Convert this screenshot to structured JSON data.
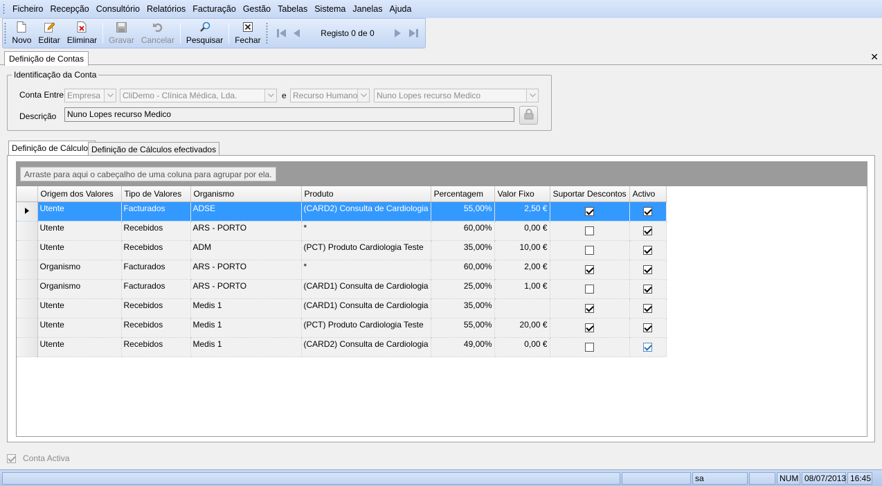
{
  "menu": [
    "Ficheiro",
    "Recepção",
    "Consultório",
    "Relatórios",
    "Facturação",
    "Gestão",
    "Tabelas",
    "Sistema",
    "Janelas",
    "Ajuda"
  ],
  "toolbar": {
    "novo": "Novo",
    "editar": "Editar",
    "eliminar": "Eliminar",
    "gravar": "Gravar",
    "cancelar": "Cancelar",
    "pesquisar": "Pesquisar",
    "fechar": "Fechar",
    "registo": "Registo 0 de 0"
  },
  "doc_tab": "Definição de Contas",
  "identificacao": {
    "legend": "Identificação da Conta",
    "conta_entre_label": "Conta Entre",
    "tipo1": "Empresa",
    "entidade1": "CliDemo - Clínica Médica, Lda.",
    "e_label": "e",
    "tipo2": "Recurso Humano",
    "entidade2": "Nuno Lopes recurso Medico",
    "descricao_label": "Descrição",
    "descricao": "Nuno Lopes recurso Medico"
  },
  "tabs": [
    "Definição de Cálculos",
    "Definição de Cálculos efectivados"
  ],
  "grid": {
    "group_hint": "Arraste para aqui o cabeçalho de uma coluna para agrupar por ela.",
    "columns": [
      "Origem dos Valores",
      "Tipo de Valores",
      "Organismo",
      "Produto",
      "Percentagem",
      "Valor Fixo",
      "Suportar Descontos",
      "Activo"
    ],
    "rows": [
      {
        "origem": "Utente",
        "tipo": "Facturados",
        "organismo": "ADSE",
        "produto": "(CARD2) Consulta de Cardiologia",
        "percentagem": "55,00%",
        "valor_fixo": "2,50 €",
        "descontos": true,
        "activo": true
      },
      {
        "origem": "Utente",
        "tipo": "Recebidos",
        "organismo": "ARS - PORTO",
        "produto": "*",
        "percentagem": "60,00%",
        "valor_fixo": "0,00 €",
        "descontos": false,
        "activo": true
      },
      {
        "origem": "Utente",
        "tipo": "Recebidos",
        "organismo": "ADM",
        "produto": "(PCT) Produto Cardiologia Teste",
        "percentagem": "35,00%",
        "valor_fixo": "10,00 €",
        "descontos": false,
        "activo": true
      },
      {
        "origem": "Organismo",
        "tipo": "Facturados",
        "organismo": "ARS - PORTO",
        "produto": "*",
        "percentagem": "60,00%",
        "valor_fixo": "2,00 €",
        "descontos": true,
        "activo": true
      },
      {
        "origem": "Organismo",
        "tipo": "Facturados",
        "organismo": "ARS - PORTO",
        "produto": "(CARD1) Consulta de Cardiologia",
        "percentagem": "25,00%",
        "valor_fixo": "1,00 €",
        "descontos": false,
        "activo": true
      },
      {
        "origem": "Utente",
        "tipo": "Recebidos",
        "organismo": "Medis 1",
        "produto": "(CARD1) Consulta de Cardiologia",
        "percentagem": "35,00%",
        "valor_fixo": "",
        "descontos": true,
        "activo": true
      },
      {
        "origem": "Utente",
        "tipo": "Recebidos",
        "organismo": "Medis 1",
        "produto": "(PCT) Produto Cardiologia Teste",
        "percentagem": "55,00%",
        "valor_fixo": "20,00 €",
        "descontos": true,
        "activo": true
      },
      {
        "origem": "Utente",
        "tipo": "Recebidos",
        "organismo": "Medis 1",
        "produto": "(CARD2) Consulta de Cardiologia",
        "percentagem": "49,00%",
        "valor_fixo": "0,00 €",
        "descontos": false,
        "activo": true
      }
    ]
  },
  "conta_activa": "Conta Activa",
  "status": {
    "user": "sa",
    "num": "NUM",
    "date": "08/07/2013",
    "time": "16:45"
  }
}
